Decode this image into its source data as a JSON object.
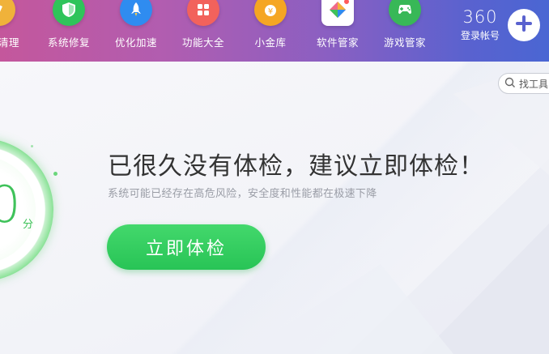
{
  "header": {
    "nav_items": [
      {
        "label": "电脑清理",
        "visible_label": "清理",
        "icon": "broom-icon",
        "color": "#f0b23a"
      },
      {
        "label": "系统修复",
        "icon": "shield-icon",
        "color": "#2fc45a"
      },
      {
        "label": "优化加速",
        "icon": "rocket-icon",
        "color": "#2f8cf0"
      },
      {
        "label": "功能大全",
        "icon": "grid-icon",
        "color": "#f2625c"
      },
      {
        "label": "小金库",
        "icon": "money-bag-icon",
        "color": "#f5a623"
      },
      {
        "label": "软件管家",
        "icon": "software-icon",
        "color": "#f06a8a"
      },
      {
        "label": "游戏管家",
        "icon": "gamepad-icon",
        "color": "#38b857"
      }
    ],
    "account": {
      "logo": "360",
      "label": "登录帐号"
    },
    "add_icon": "plus-icon"
  },
  "main": {
    "search": {
      "placeholder": "找工具",
      "visible_text": "找工具"
    },
    "score": {
      "value": "0",
      "unit": "分"
    },
    "headline": "已很久没有体检，建议立即体检！",
    "subline": "系统可能已经存在高危风险，安全度和性能都在极速下降",
    "check_button": "立即体检"
  },
  "colors": {
    "accent_green": "#2fc45a",
    "headline": "#333333",
    "subline": "#9a9da6"
  }
}
